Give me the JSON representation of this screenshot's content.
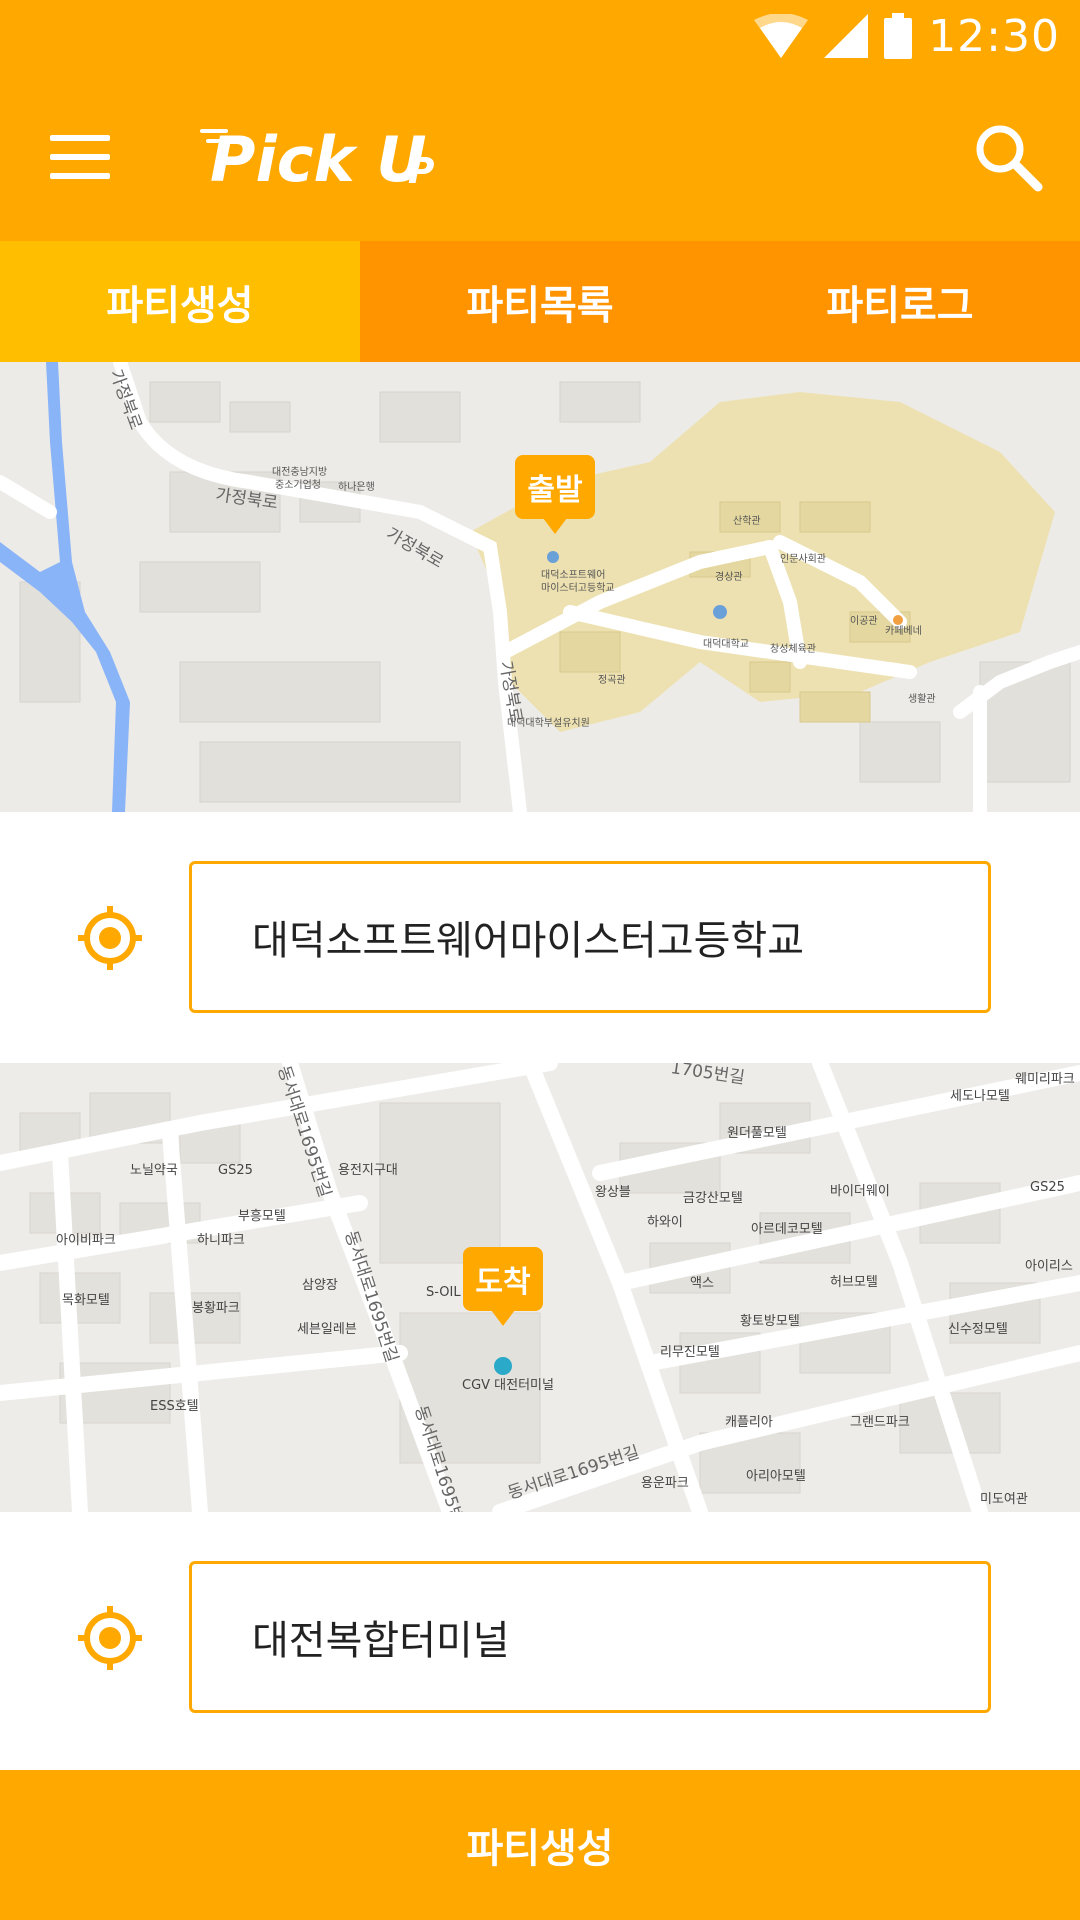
{
  "status_bar": {
    "time": "12:30",
    "icons": [
      "wifi-icon",
      "signal-icon",
      "battery-icon"
    ]
  },
  "app_bar": {
    "logo_text": "Pick Up",
    "menu_icon": "hamburger-menu-icon",
    "search_icon": "search-icon"
  },
  "tabs": [
    {
      "label": "파티생성",
      "active": true
    },
    {
      "label": "파티목록",
      "active": false
    },
    {
      "label": "파티로그",
      "active": false
    }
  ],
  "departure_map": {
    "pin_label": "출발",
    "labels": [
      "가정북로",
      "가정북로",
      "가정북로",
      "가정북로",
      "대전충남지방중소기업청",
      "하나은행",
      "대덕소프트웨어마이스터고등학교",
      "산학관",
      "인문사회관",
      "경상관",
      "대덕대학교",
      "이공관",
      "카페베네",
      "창성체육관",
      "정곡관",
      "생활관",
      "대덕대학부설유치원"
    ]
  },
  "departure": {
    "value": "대덕소프트웨어마이스터고등학교",
    "icon": "target-location-icon"
  },
  "arrival_map": {
    "pin_label": "도착",
    "labels": [
      "동서대로1695번길",
      "동서대로1695번길",
      "동서대로1695번길",
      "동서대로1695번길",
      "1705번길",
      "노닐약국",
      "GS25",
      "용전지구대",
      "원더풀모텔",
      "세도나모텔",
      "웨미리파크",
      "부흥모텔",
      "왕상블",
      "금강산모텔",
      "바이더웨이",
      "GS25",
      "아이비파크",
      "하니파크",
      "하와이",
      "아르데코모텔",
      "목화모텔",
      "삼양장",
      "S-OIL",
      "액스",
      "허브모텔",
      "아이리스",
      "봉황파크",
      "세븐일레븐",
      "황토방모텔",
      "신수정모텔",
      "리무진모텔",
      "CGV 대전터미널",
      "ESS호텔",
      "캐플리아",
      "그랜드파크",
      "용운파크",
      "아리아모텔",
      "미도여관"
    ]
  },
  "arrival": {
    "value": "대전복합터미널",
    "icon": "target-location-icon"
  },
  "submit": {
    "label": "파티생성"
  },
  "colors": {
    "primary": "#FFA800",
    "tab_active": "#FFBE00",
    "tab_inactive": "#FF9300",
    "campus": "#EEDFA8"
  }
}
